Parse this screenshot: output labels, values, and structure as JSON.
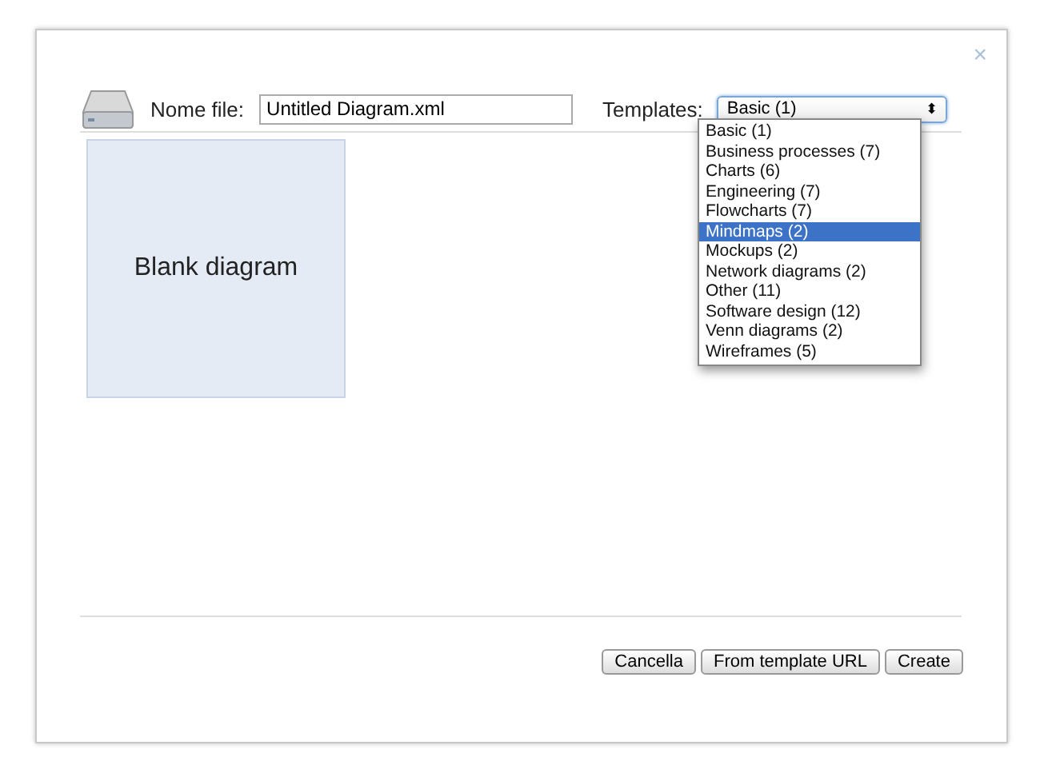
{
  "close": "×",
  "file": {
    "label": "Nome file:",
    "value": "Untitled Diagram.xml"
  },
  "templates": {
    "label": "Templates:",
    "value": "Basic (1)",
    "arrows": "⬍",
    "options": [
      {
        "label": "Basic (1)",
        "highlighted": false
      },
      {
        "label": "Business processes (7)",
        "highlighted": false
      },
      {
        "label": "Charts (6)",
        "highlighted": false
      },
      {
        "label": "Engineering (7)",
        "highlighted": false
      },
      {
        "label": "Flowcharts (7)",
        "highlighted": false
      },
      {
        "label": "Mindmaps (2)",
        "highlighted": true
      },
      {
        "label": "Mockups (2)",
        "highlighted": false
      },
      {
        "label": "Network diagrams (2)",
        "highlighted": false
      },
      {
        "label": "Other (11)",
        "highlighted": false
      },
      {
        "label": "Software design (12)",
        "highlighted": false
      },
      {
        "label": "Venn diagrams (2)",
        "highlighted": false
      },
      {
        "label": "Wireframes (5)",
        "highlighted": false
      }
    ]
  },
  "tiles": [
    {
      "label": "Blank diagram"
    }
  ],
  "buttons": [
    "Cancella",
    "From template URL",
    "Create"
  ]
}
